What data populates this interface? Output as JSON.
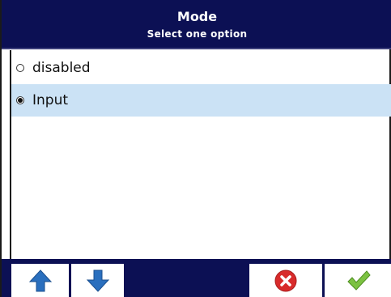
{
  "header": {
    "title": "Mode",
    "subtitle": "Select one option"
  },
  "options": [
    {
      "label": "disabled",
      "selected": false
    },
    {
      "label": "Input",
      "selected": true
    }
  ],
  "toolbar": {
    "buttons": [
      {
        "name": "up-arrow-button",
        "icon": "up-arrow-icon"
      },
      {
        "name": "down-arrow-button",
        "icon": "down-arrow-icon"
      },
      {
        "name": "cancel-button",
        "icon": "cancel-icon"
      },
      {
        "name": "confirm-button",
        "icon": "checkmark-icon"
      }
    ]
  },
  "colors": {
    "header_bg": "#0c1054",
    "selected_row_bg": "#cbe2f5",
    "arrow_blue": "#2a6fbe",
    "cancel_red": "#d82b2b",
    "confirm_green": "#7cc242"
  }
}
